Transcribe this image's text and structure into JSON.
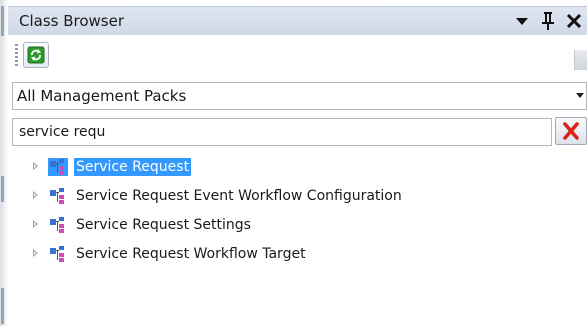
{
  "window": {
    "title": "Class Browser",
    "controls": {
      "menu_icon": "chevron-down-icon",
      "pin_icon": "pin-icon",
      "close_icon": "close-icon"
    }
  },
  "toolbar": {
    "refresh_icon": "refresh-icon"
  },
  "filter": {
    "selected_option": "All Management Packs"
  },
  "search": {
    "value": "service requ",
    "clear_icon": "red-x-icon"
  },
  "tree": {
    "items": [
      {
        "label": "Service Request",
        "selected": true
      },
      {
        "label": "Service Request Event Workflow Configuration",
        "selected": false
      },
      {
        "label": "Service Request Settings",
        "selected": false
      },
      {
        "label": "Service Request Workflow Target",
        "selected": false
      }
    ]
  },
  "colors": {
    "title_bar": "#d4dded",
    "selection": "#3399ff",
    "clear_red": "#d9241c",
    "refresh_green": "#2e9a2e",
    "icon_blue": "#3a6fd8",
    "icon_pink": "#d04ab8"
  }
}
